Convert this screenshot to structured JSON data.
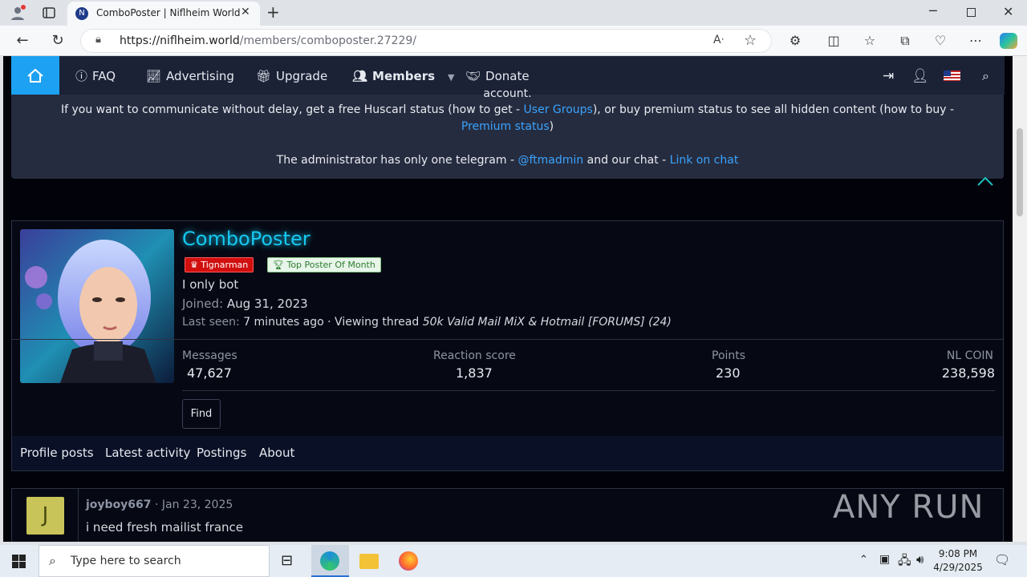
{
  "browser": {
    "tab_title": "ComboPoster | Niflheim World",
    "url_host": "https://niflheim.world",
    "url_path": "/members/comboposter.27229/"
  },
  "nav": {
    "faq": "FAQ",
    "advertising": "Advertising",
    "upgrade": "Upgrade",
    "members": "Members",
    "donate": "Donate"
  },
  "notice": {
    "cut_text": "account.",
    "line1_a": "If you want to communicate without delay, get a free Huscarl status (how to get - ",
    "line1_link": "User Groups",
    "line1_b": "), or buy premium status to see all hidden content (how to buy - ",
    "line2_link": "Premium status",
    "line2_b": ")",
    "line3_a": "The administrator has only one telegram - ",
    "line3_link1": "@ftmadmin",
    "line3_b": " and our chat - ",
    "line3_link2": "Link on chat"
  },
  "profile": {
    "username": "ComboPoster",
    "badge1": "Tignarman",
    "badge2": "Top Poster Of Month",
    "status": "I only bot",
    "joined_label": "Joined:",
    "joined_value": "Aug 31, 2023",
    "lastseen_label": "Last seen:",
    "lastseen_value": "7 minutes ago · Viewing thread ",
    "lastseen_thread": "50k Valid Mail MiX & Hotmail [FORUMS] (24)",
    "stats": [
      {
        "label": "Messages",
        "value": "47,627"
      },
      {
        "label": "Reaction score",
        "value": "1,837"
      },
      {
        "label": "Points",
        "value": "230"
      },
      {
        "label": "NL COIN",
        "value": "238,598"
      }
    ],
    "find_button": "Find",
    "tabs": [
      "Profile posts",
      "Latest activity",
      "Postings",
      "About"
    ]
  },
  "post": {
    "avatar_letter": "J",
    "author": "joyboy667",
    "date": "· Jan 23, 2025",
    "text": "i need fresh mailist france"
  },
  "watermark": "ANY RUN",
  "taskbar": {
    "search_placeholder": "Type here to search",
    "time": "9:08 PM",
    "date": "4/29/2025"
  },
  "colors": {
    "accent": "#1da1f2",
    "username": "#16c8f0",
    "badge1_bg": "#d10f0f",
    "badge2_bg": "#e8f5e9"
  }
}
